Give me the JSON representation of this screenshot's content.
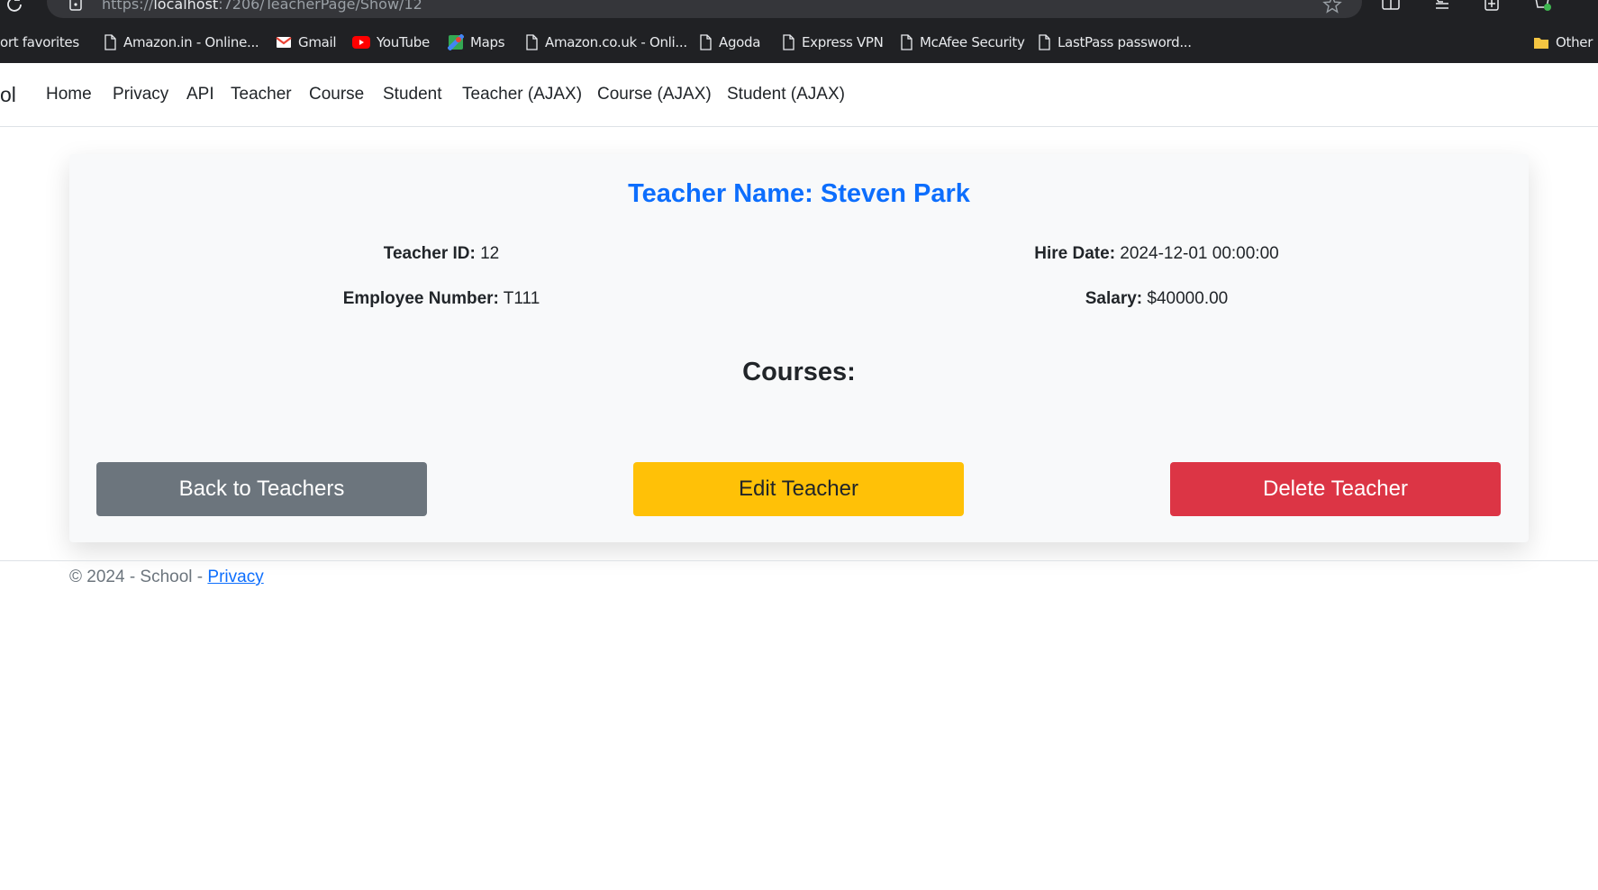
{
  "browser": {
    "url_prefix": "https://",
    "url_host": "localhost",
    "url_rest": ":7206/TeacherPage/Show/12",
    "bookmarks": [
      {
        "label": "ort favorites",
        "icon": "none"
      },
      {
        "label": "Amazon.in - Online...",
        "icon": "page-icon"
      },
      {
        "label": "Gmail",
        "icon": "gmail-icon"
      },
      {
        "label": "YouTube",
        "icon": "youtube-icon"
      },
      {
        "label": "Maps",
        "icon": "maps-icon"
      },
      {
        "label": "Amazon.co.uk - Onli...",
        "icon": "page-icon"
      },
      {
        "label": "Agoda",
        "icon": "page-icon"
      },
      {
        "label": "Express VPN",
        "icon": "page-icon"
      },
      {
        "label": "McAfee Security",
        "icon": "page-icon"
      },
      {
        "label": "LastPass password...",
        "icon": "page-icon"
      },
      {
        "label": "Other",
        "icon": "folder-icon"
      }
    ]
  },
  "nav": {
    "brand": "ol",
    "links": [
      "Home",
      "Privacy",
      "API",
      "Teacher",
      "Course",
      "Student",
      "Teacher (AJAX)",
      "Course (AJAX)",
      "Student (AJAX)"
    ]
  },
  "teacher": {
    "title": "Teacher Name: Steven Park",
    "id_label": "Teacher ID:",
    "id_value": "12",
    "hire_label": "Hire Date:",
    "hire_value": "2024-12-01 00:00:00",
    "emp_label": "Employee Number:",
    "emp_value": "T111",
    "salary_label": "Salary:",
    "salary_value": "$40000.00",
    "courses_title": "Courses:"
  },
  "actions": {
    "back": "Back to Teachers",
    "edit": "Edit Teacher",
    "delete": "Delete Teacher"
  },
  "footer": {
    "text": "© 2024 - School - ",
    "link": "Privacy"
  },
  "colors": {
    "primary": "#0d6efd",
    "secondary": "#6c757d",
    "warning": "#ffc107",
    "danger": "#dc3545",
    "card_bg": "#f8f9fa",
    "chrome_bg": "#202124"
  }
}
